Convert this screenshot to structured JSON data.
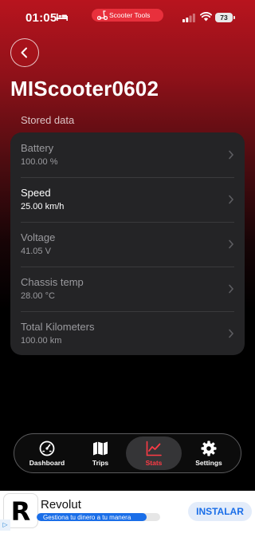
{
  "status_bar": {
    "time": "01:05",
    "app_pill": "Scooter Tools",
    "battery": "73"
  },
  "header": {
    "title": "MIScooter0602",
    "section_label": "Stored data"
  },
  "stored_data": {
    "items": [
      {
        "label": "Battery",
        "value": "100.00 %"
      },
      {
        "label": "Speed",
        "value": "25.00 km/h"
      },
      {
        "label": "Voltage",
        "value": "41.05 V"
      },
      {
        "label": "Chassis temp",
        "value": "28.00 °C"
      },
      {
        "label": "Total Kilometers",
        "value": "100.00 km"
      }
    ]
  },
  "tabs": [
    {
      "label": "Dashboard",
      "icon": "gauge-icon"
    },
    {
      "label": "Trips",
      "icon": "map-icon"
    },
    {
      "label": "Stats",
      "icon": "chart-icon"
    },
    {
      "label": "Settings",
      "icon": "gear-icon"
    }
  ],
  "ad": {
    "logo_letter": "R",
    "title": "Revolut",
    "subtitle": "Gestiona tu dinero a tu manera",
    "cta": "INSTALAR",
    "progress": 0.89
  },
  "colors": {
    "accent": "#e8303c",
    "active_tab_label": "#ff3b45",
    "card_bg": "#242426",
    "ad_blue": "#1a6ee8"
  }
}
